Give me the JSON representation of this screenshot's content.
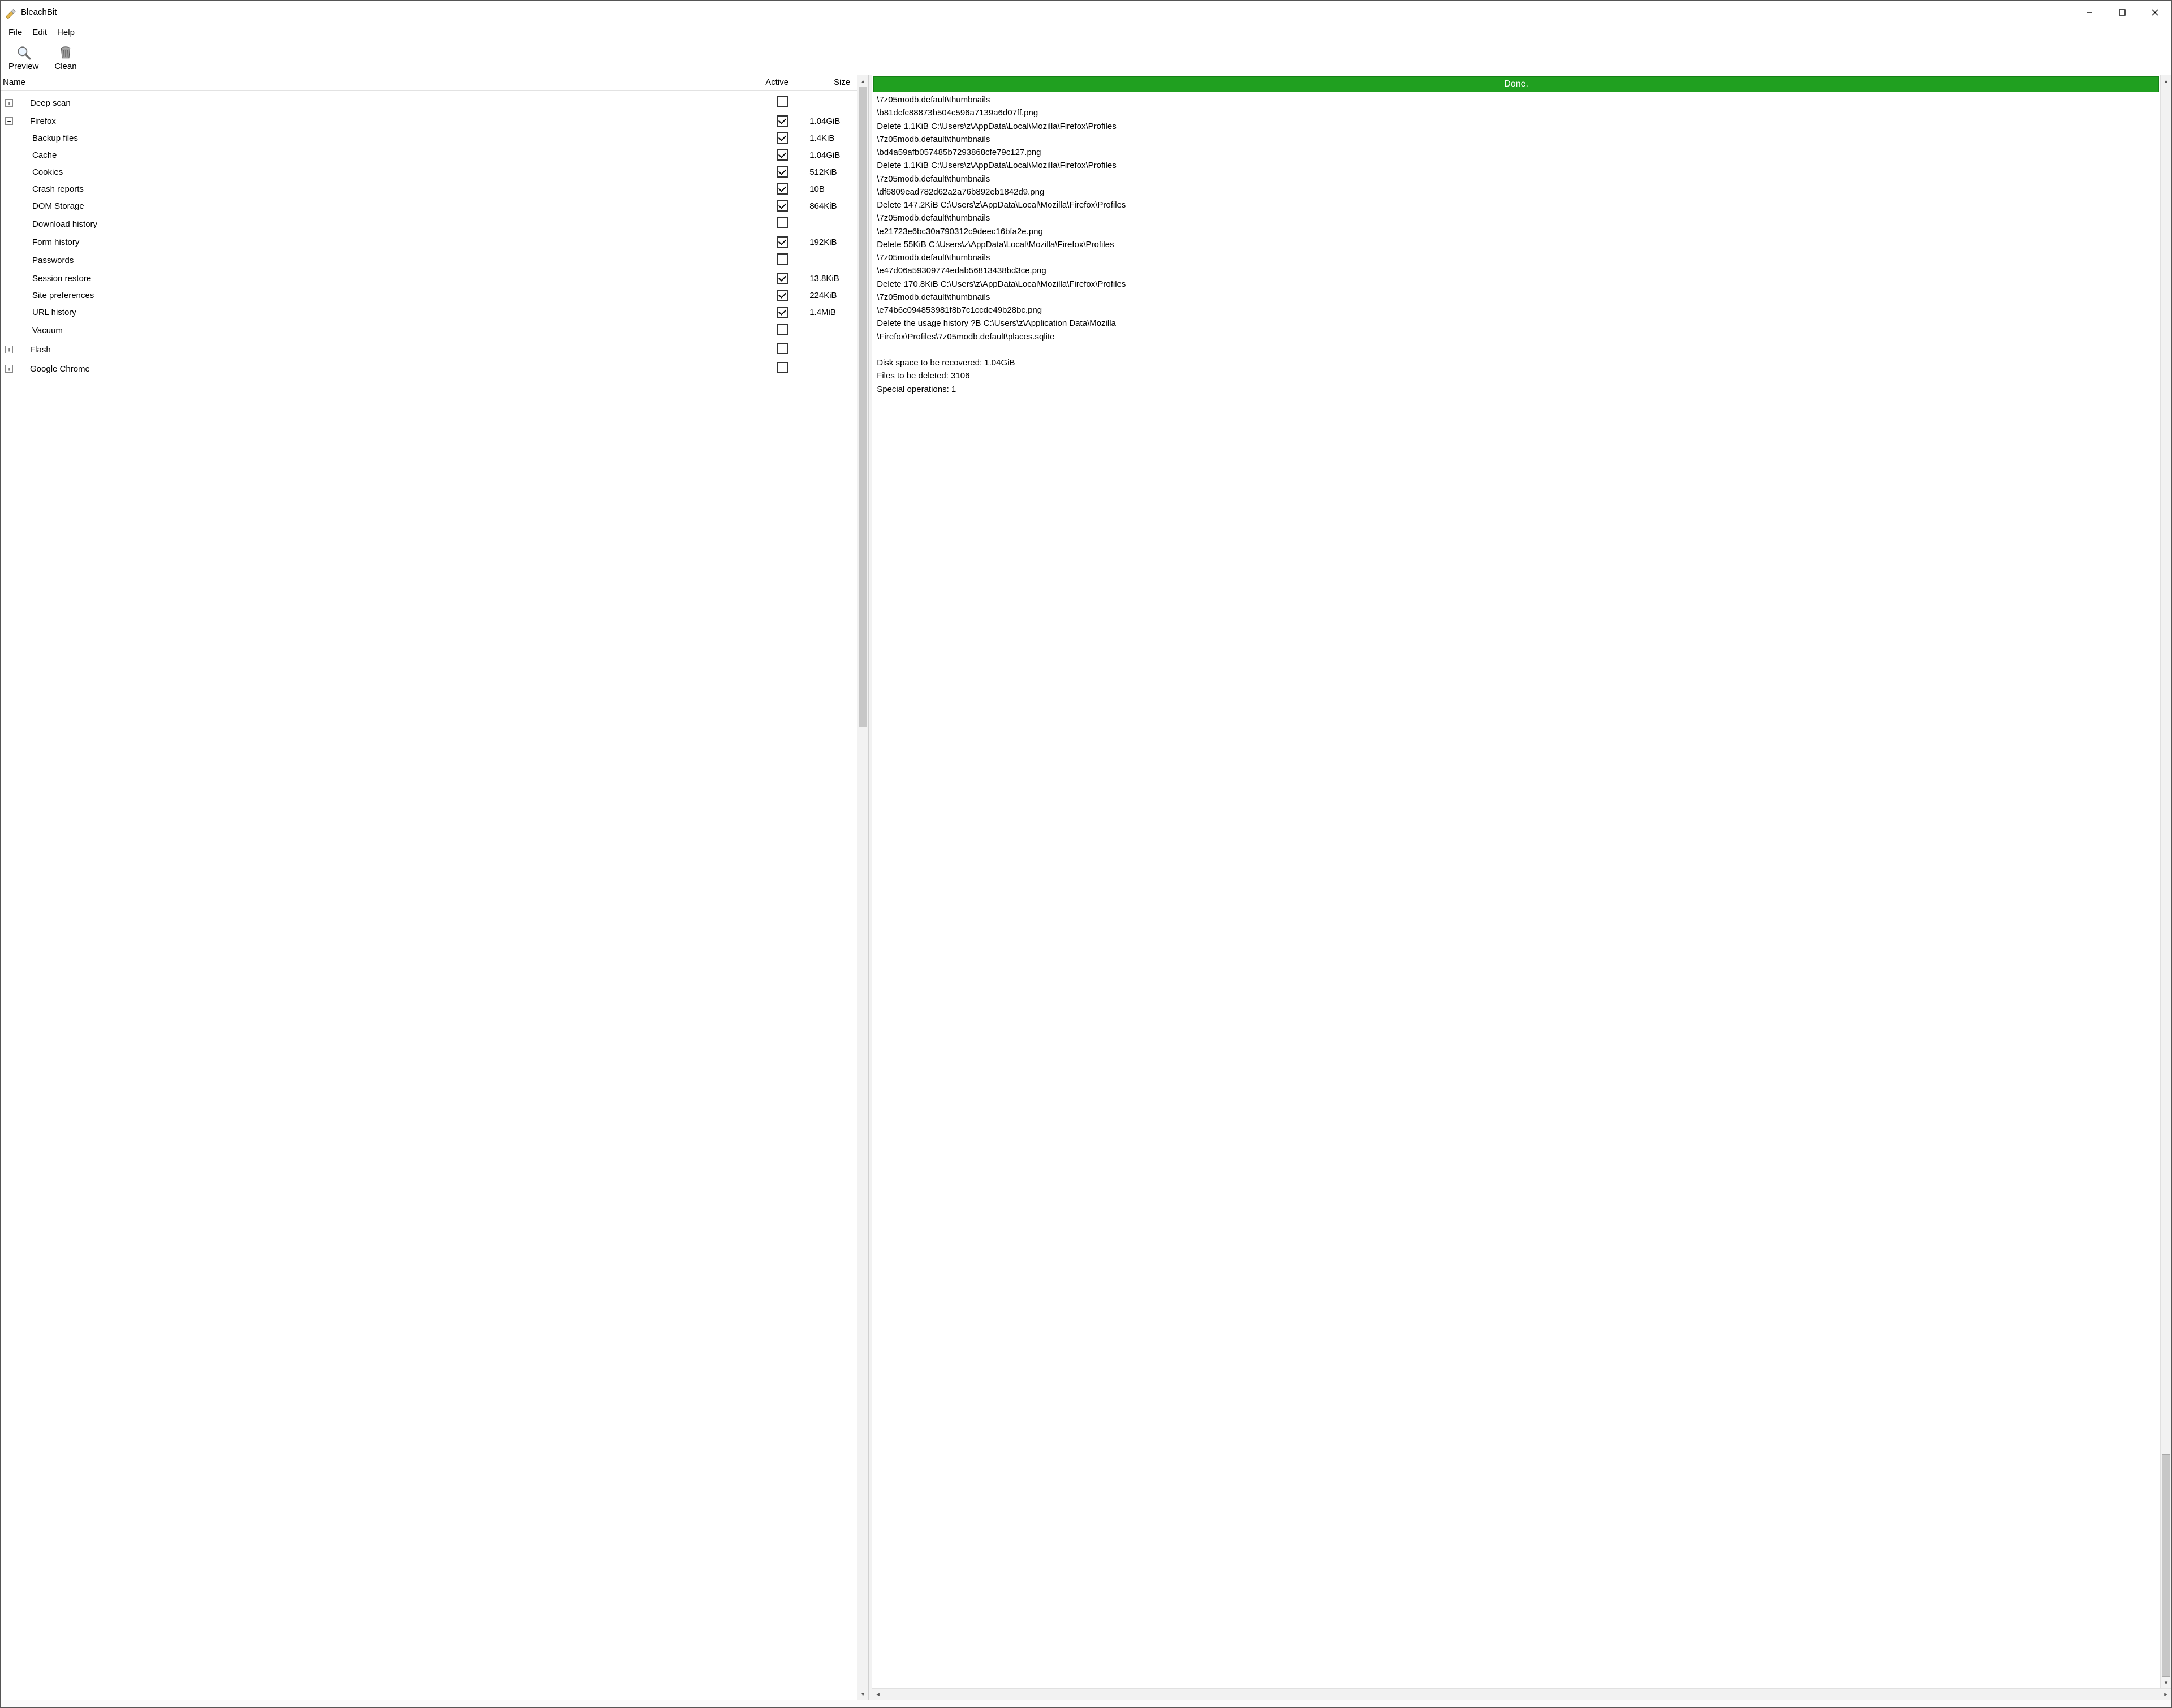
{
  "window": {
    "title": "BleachBit"
  },
  "menu": {
    "file": "File",
    "edit": "Edit",
    "help": "Help"
  },
  "toolbar": {
    "preview": "Preview",
    "clean": "Clean"
  },
  "columns": {
    "name": "Name",
    "active": "Active",
    "size": "Size"
  },
  "tree": [
    {
      "id": "deepscan",
      "depth": 0,
      "expand": "plus",
      "label": "Deep scan",
      "checked": false,
      "size": ""
    },
    {
      "id": "firefox",
      "depth": 0,
      "expand": "minus",
      "label": "Firefox",
      "checked": true,
      "size": "1.04GiB"
    },
    {
      "id": "ff-backup",
      "depth": 1,
      "expand": "",
      "label": "Backup files",
      "checked": true,
      "size": "1.4KiB"
    },
    {
      "id": "ff-cache",
      "depth": 1,
      "expand": "",
      "label": "Cache",
      "checked": true,
      "size": "1.04GiB"
    },
    {
      "id": "ff-cookies",
      "depth": 1,
      "expand": "",
      "label": "Cookies",
      "checked": true,
      "size": "512KiB"
    },
    {
      "id": "ff-crash",
      "depth": 1,
      "expand": "",
      "label": "Crash reports",
      "checked": true,
      "size": "10B"
    },
    {
      "id": "ff-dom",
      "depth": 1,
      "expand": "",
      "label": "DOM Storage",
      "checked": true,
      "size": "864KiB"
    },
    {
      "id": "ff-dl",
      "depth": 1,
      "expand": "",
      "label": "Download history",
      "checked": false,
      "size": ""
    },
    {
      "id": "ff-form",
      "depth": 1,
      "expand": "",
      "label": "Form history",
      "checked": true,
      "size": "192KiB"
    },
    {
      "id": "ff-pw",
      "depth": 1,
      "expand": "",
      "label": "Passwords",
      "checked": false,
      "size": ""
    },
    {
      "id": "ff-sess",
      "depth": 1,
      "expand": "",
      "label": "Session restore",
      "checked": true,
      "size": "13.8KiB"
    },
    {
      "id": "ff-site",
      "depth": 1,
      "expand": "",
      "label": "Site preferences",
      "checked": true,
      "size": "224KiB"
    },
    {
      "id": "ff-url",
      "depth": 1,
      "expand": "",
      "label": "URL history",
      "checked": true,
      "size": "1.4MiB"
    },
    {
      "id": "ff-vac",
      "depth": 1,
      "expand": "",
      "label": "Vacuum",
      "checked": false,
      "size": ""
    },
    {
      "id": "flash",
      "depth": 0,
      "expand": "plus",
      "label": "Flash",
      "checked": false,
      "size": ""
    },
    {
      "id": "chrome",
      "depth": 0,
      "expand": "plus",
      "label": "Google Chrome",
      "checked": false,
      "size": ""
    }
  ],
  "progress": {
    "label": "Done."
  },
  "log_lines": [
    "\\7z05modb.default\\thumbnails",
    "\\b81dcfc88873b504c596a7139a6d07ff.png",
    "Delete 1.1KiB C:\\Users\\z\\AppData\\Local\\Mozilla\\Firefox\\Profiles",
    "\\7z05modb.default\\thumbnails",
    "\\bd4a59afb057485b7293868cfe79c127.png",
    "Delete 1.1KiB C:\\Users\\z\\AppData\\Local\\Mozilla\\Firefox\\Profiles",
    "\\7z05modb.default\\thumbnails",
    "\\df6809ead782d62a2a76b892eb1842d9.png",
    "Delete 147.2KiB C:\\Users\\z\\AppData\\Local\\Mozilla\\Firefox\\Profiles",
    "\\7z05modb.default\\thumbnails",
    "\\e21723e6bc30a790312c9deec16bfa2e.png",
    "Delete 55KiB C:\\Users\\z\\AppData\\Local\\Mozilla\\Firefox\\Profiles",
    "\\7z05modb.default\\thumbnails",
    "\\e47d06a59309774edab56813438bd3ce.png",
    "Delete 170.8KiB C:\\Users\\z\\AppData\\Local\\Mozilla\\Firefox\\Profiles",
    "\\7z05modb.default\\thumbnails",
    "\\e74b6c094853981f8b7c1ccde49b28bc.png",
    "Delete the usage history ?B C:\\Users\\z\\Application Data\\Mozilla",
    "\\Firefox\\Profiles\\7z05modb.default\\places.sqlite",
    "",
    "Disk space to be recovered: 1.04GiB",
    "Files to be deleted: 3106",
    "Special operations: 1"
  ]
}
